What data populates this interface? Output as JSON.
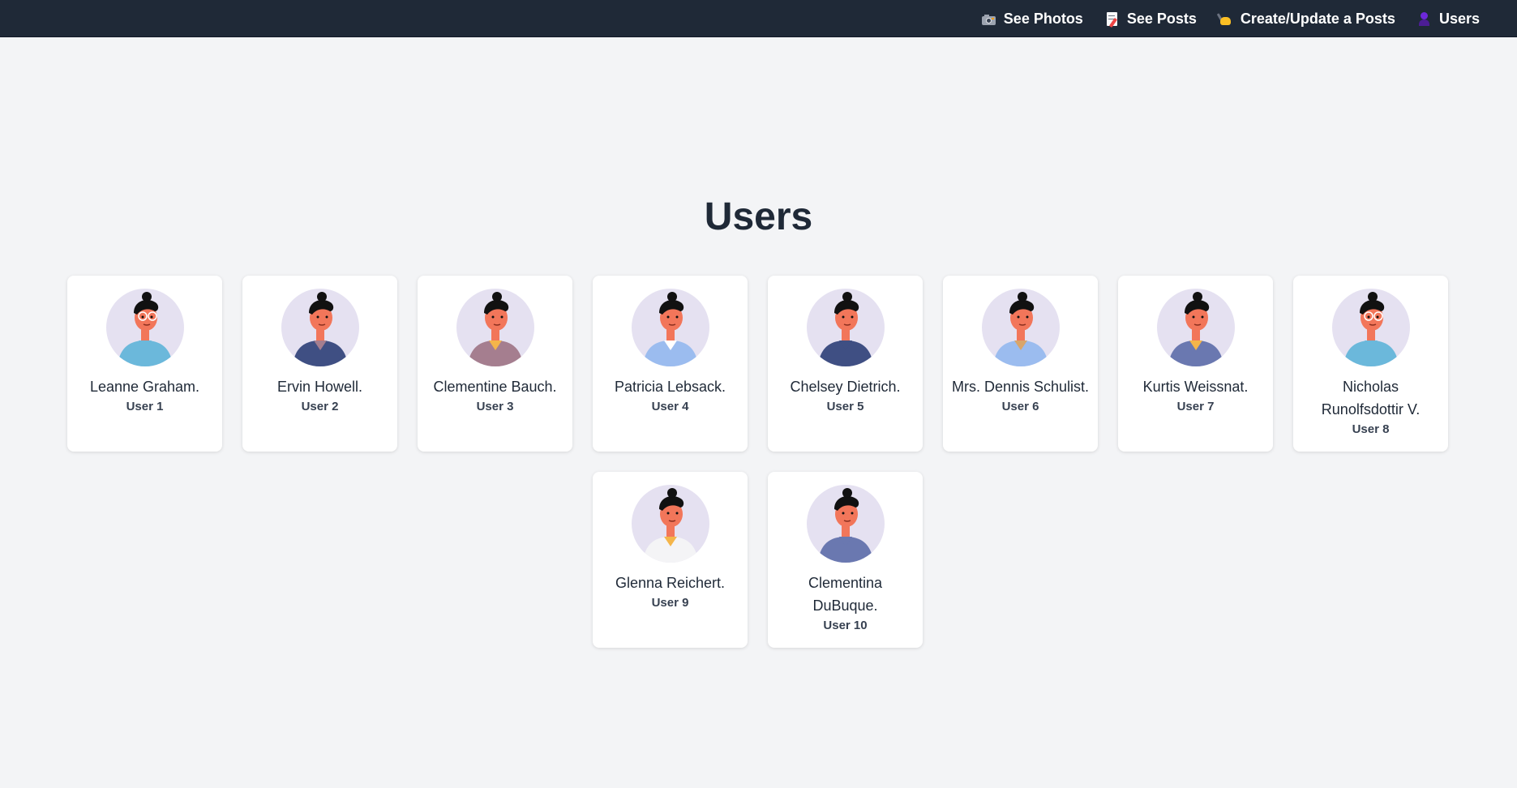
{
  "nav": {
    "items": [
      {
        "label": "See Photos",
        "icon": "camera-icon"
      },
      {
        "label": "See Posts",
        "icon": "memo-icon"
      },
      {
        "label": "Create/Update a Posts",
        "icon": "writing-hand-icon"
      },
      {
        "label": "Users",
        "icon": "person-icon"
      }
    ]
  },
  "page": {
    "title": "Users"
  },
  "users": [
    {
      "name": "Leanne Graham.",
      "id_label": "User 1",
      "shirt": "#6bb8db",
      "collar": "#6bb8db",
      "glasses": true
    },
    {
      "name": "Ervin Howell.",
      "id_label": "User 2",
      "shirt": "#3f4f83",
      "collar": "#a57e8f",
      "glasses": false
    },
    {
      "name": "Clementine Bauch.",
      "id_label": "User 3",
      "shirt": "#a57e8f",
      "collar": "#f4b54a",
      "glasses": false
    },
    {
      "name": "Patricia Lebsack.",
      "id_label": "User 4",
      "shirt": "#9bbcef",
      "collar": "#ffffff",
      "glasses": false
    },
    {
      "name": "Chelsey Dietrich.",
      "id_label": "User 5",
      "shirt": "#3f4f83",
      "collar": "#3f4f83",
      "glasses": false
    },
    {
      "name": "Mrs. Dennis Schulist.",
      "id_label": "User 6",
      "shirt": "#9bbcef",
      "collar": "#d9a56a",
      "glasses": false
    },
    {
      "name": "Kurtis Weissnat.",
      "id_label": "User 7",
      "shirt": "#6a78b0",
      "collar": "#f4b54a",
      "glasses": false
    },
    {
      "name": "Nicholas Runolfsdottir V.",
      "id_label": "User 8",
      "shirt": "#6bb8db",
      "collar": "#6bb8db",
      "glasses": true
    },
    {
      "name": "Glenna Reichert.",
      "id_label": "User 9",
      "shirt": "#f4f4f6",
      "collar": "#f4b54a",
      "glasses": false
    },
    {
      "name": "Clementina DuBuque.",
      "id_label": "User 10",
      "shirt": "#6a78b0",
      "collar": "#6a78b0",
      "glasses": false
    }
  ]
}
